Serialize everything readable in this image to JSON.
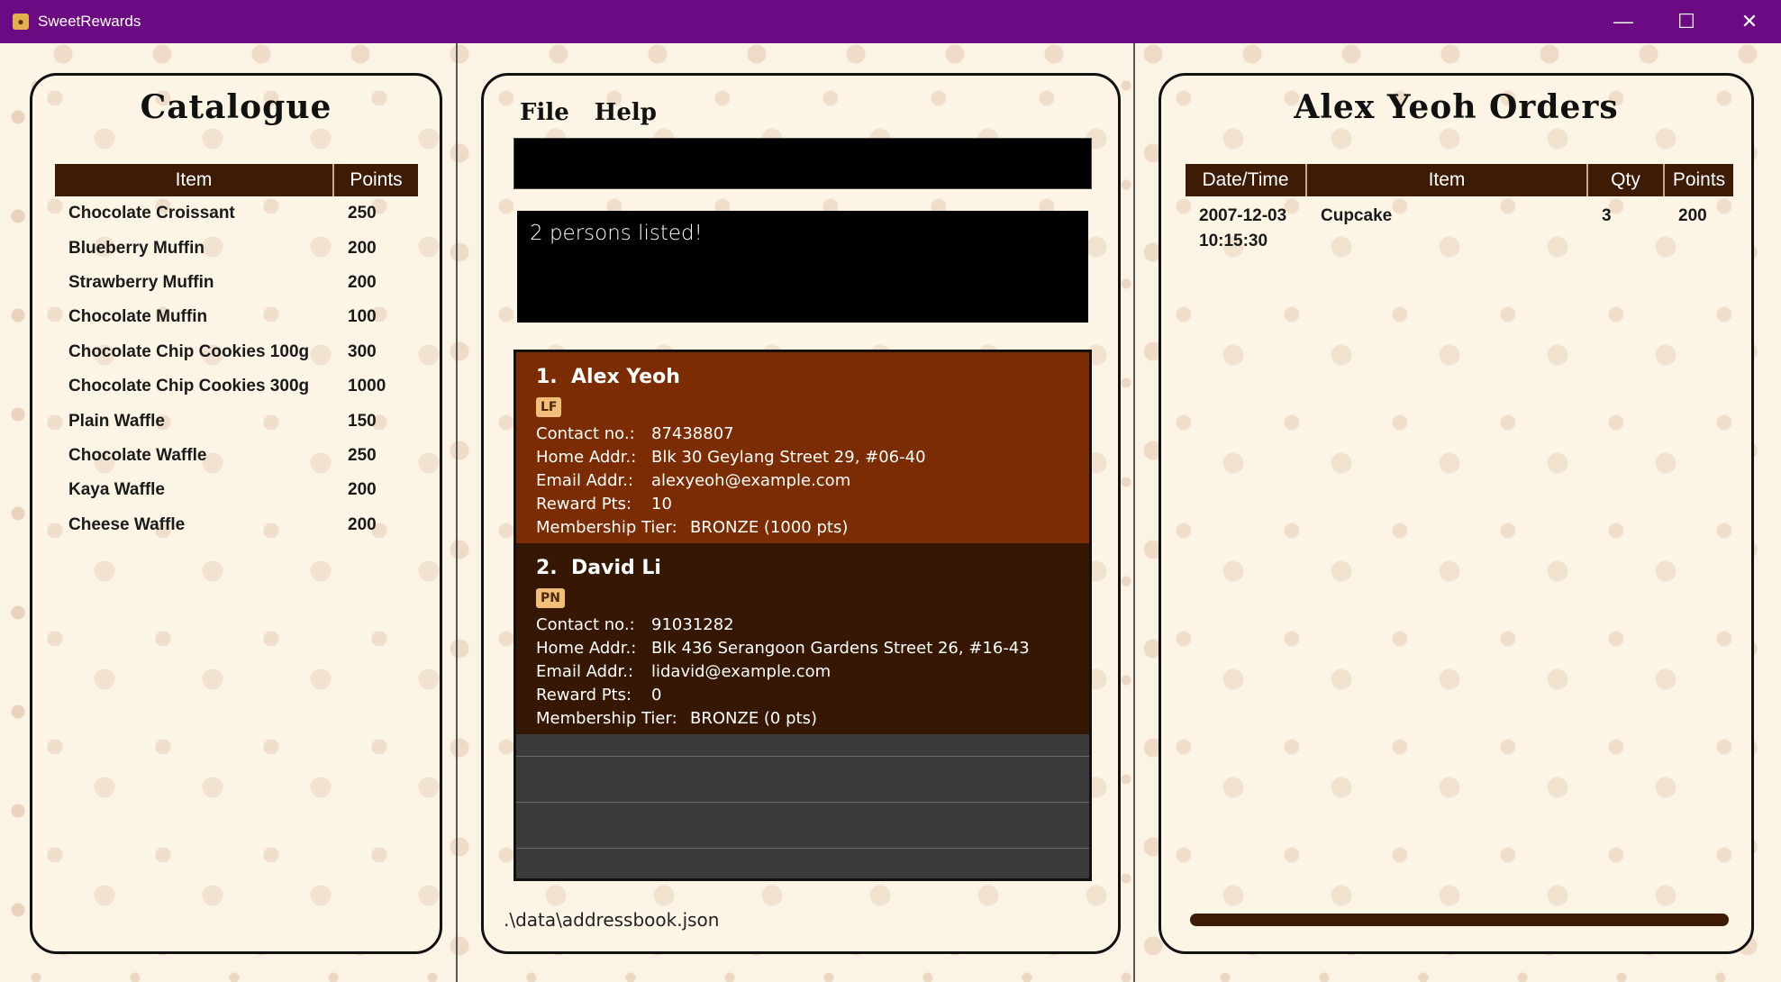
{
  "window": {
    "title": "SweetRewards",
    "icon": "app-icon"
  },
  "catalogue": {
    "title": "Catalogue",
    "headers": [
      "Item",
      "Points"
    ],
    "rows": [
      {
        "item": "Chocolate Croissant",
        "points": "250"
      },
      {
        "item": "Blueberry Muffin",
        "points": "200"
      },
      {
        "item": "Strawberry Muffin",
        "points": "200"
      },
      {
        "item": "Chocolate Muffin",
        "points": "100"
      },
      {
        "item": "Chocolate Chip Cookies 100g",
        "points": "300"
      },
      {
        "item": "Chocolate Chip Cookies 300g",
        "points": "1000"
      },
      {
        "item": "Plain Waffle",
        "points": "150"
      },
      {
        "item": "Chocolate Waffle",
        "points": "250"
      },
      {
        "item": "Kaya Waffle",
        "points": "200"
      },
      {
        "item": "Cheese Waffle",
        "points": "200"
      }
    ]
  },
  "menu": {
    "file": "File",
    "help": "Help"
  },
  "command": {
    "value": ""
  },
  "result": {
    "text": "2 persons listed!"
  },
  "persons": [
    {
      "index": "1.",
      "name": "Alex Yeoh",
      "tag": "LF",
      "contact_label": "Contact no.:",
      "contact": "87438807",
      "home_label": "Home Addr.:",
      "home": "Blk 30 Geylang Street 29, #06-40",
      "email_label": "Email Addr.:",
      "email": "alexyeoh@example.com",
      "reward_label": "Reward Pts:",
      "reward": "10",
      "tier_label": "Membership Tier:",
      "tier": "BRONZE (1000 pts)"
    },
    {
      "index": "2.",
      "name": "David Li",
      "tag": "PN",
      "contact_label": "Contact no.:",
      "contact": "91031282",
      "home_label": "Home Addr.:",
      "home": "Blk 436 Serangoon Gardens Street 26, #16-43",
      "email_label": "Email Addr.:",
      "email": "lidavid@example.com",
      "reward_label": "Reward Pts:",
      "reward": "0",
      "tier_label": "Membership Tier:",
      "tier": "BRONZE (0 pts)"
    }
  ],
  "status": {
    "path": ".\\data\\addressbook.json"
  },
  "orders": {
    "title": "Alex Yeoh Orders",
    "headers": [
      "Date/Time",
      "Item",
      "Qty",
      "Points"
    ],
    "rows": [
      {
        "datetime_date": "2007-12-03",
        "datetime_time": "10:15:30",
        "item": "Cupcake",
        "qty": "3",
        "points": "200"
      }
    ]
  },
  "colors": {
    "titlebar": "#6b0a82",
    "table_header": "#3e1b05",
    "card_selected": "#7b2c02",
    "card_default": "#351703",
    "tag": "#f2be7a"
  }
}
